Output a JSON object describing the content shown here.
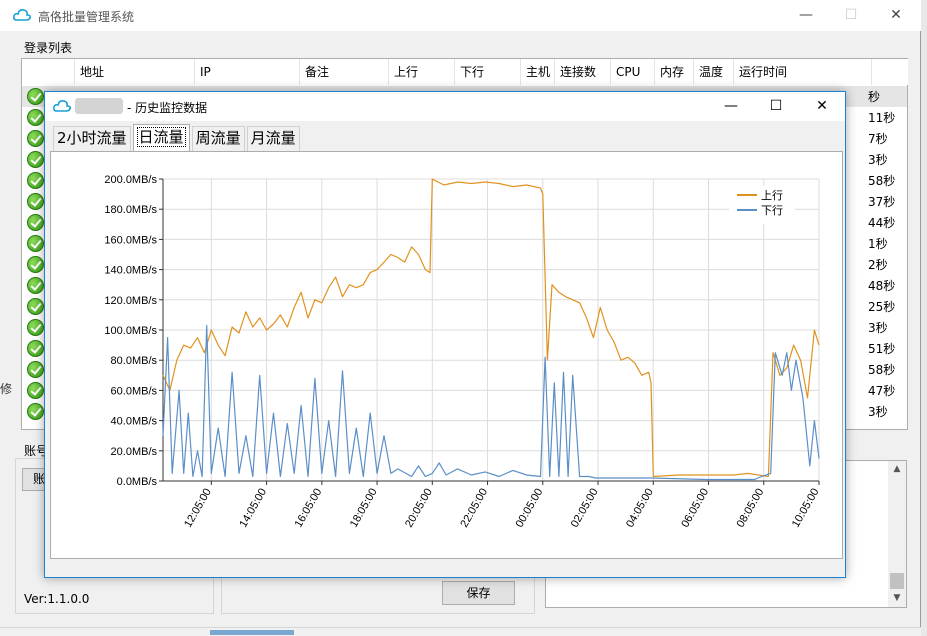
{
  "main_window": {
    "title": "高佫批量管理系统",
    "section_label": "登录列表",
    "columns": [
      "",
      "地址",
      "IP",
      "备注",
      "上行",
      "下行",
      "主机",
      "连接数",
      "CPU",
      "内存",
      "温度",
      "运行时间"
    ],
    "runtime_fragments": [
      "秒",
      "11秒",
      "7秒",
      "3秒",
      "58秒",
      "37秒",
      "44秒",
      "1秒",
      "2秒",
      "48秒",
      "25秒",
      "3秒",
      "51秒",
      "58秒",
      "47秒",
      "3秒"
    ],
    "left_fragment": "修",
    "account_label": "账号",
    "account_button_fragment": "账",
    "version": "Ver:1.1.0.0",
    "save_label": "保存"
  },
  "window_controls": {
    "minimize": "—",
    "maximize": "☐",
    "close": "✕"
  },
  "dialog": {
    "title": "- 历史监控数据",
    "tabs": [
      {
        "label": "2小时流量",
        "active": false
      },
      {
        "label": "日流量",
        "active": true
      },
      {
        "label": "周流量",
        "active": false
      },
      {
        "label": "月流量",
        "active": false
      }
    ]
  },
  "colors": {
    "upstream": "#e0921f",
    "downstream": "#5b8fc8",
    "accent_border": "#1883d7"
  },
  "icons": {
    "app": "cloud-icon"
  },
  "chart_data": {
    "type": "line",
    "y_unit": "MB/s",
    "ylim": [
      0,
      200
    ],
    "y_ticks": [
      "0.0MB/s",
      "20.0MB/s",
      "40.0MB/s",
      "60.0MB/s",
      "80.0MB/s",
      "100.0MB/s",
      "120.0MB/s",
      "140.0MB/s",
      "160.0MB/s",
      "180.0MB/s",
      "200.0MB/s"
    ],
    "x_ticks": [
      "12:05:00",
      "14:05:00",
      "16:05:00",
      "18:05:00",
      "20:05:00",
      "22:05:00",
      "00:05:00",
      "02:05:00",
      "04:05:00",
      "06:05:00",
      "08:05:00",
      "10:05:00"
    ],
    "xlim": [
      "10:20:00",
      "10:05:00"
    ],
    "grid": true,
    "legend_position": "top-right",
    "series": [
      {
        "name": "上行",
        "points": [
          [
            "10:20",
            70
          ],
          [
            "10:35",
            60
          ],
          [
            "10:50",
            80
          ],
          [
            "11:05",
            90
          ],
          [
            "11:20",
            88
          ],
          [
            "11:35",
            95
          ],
          [
            "11:50",
            85
          ],
          [
            "12:05",
            100
          ],
          [
            "12:20",
            90
          ],
          [
            "12:35",
            83
          ],
          [
            "12:50",
            102
          ],
          [
            "13:05",
            98
          ],
          [
            "13:20",
            112
          ],
          [
            "13:35",
            102
          ],
          [
            "13:50",
            108
          ],
          [
            "14:05",
            100
          ],
          [
            "14:20",
            104
          ],
          [
            "14:35",
            110
          ],
          [
            "14:50",
            102
          ],
          [
            "15:05",
            115
          ],
          [
            "15:20",
            125
          ],
          [
            "15:35",
            108
          ],
          [
            "15:50",
            120
          ],
          [
            "16:05",
            118
          ],
          [
            "16:20",
            128
          ],
          [
            "16:35",
            135
          ],
          [
            "16:50",
            122
          ],
          [
            "17:05",
            130
          ],
          [
            "17:20",
            128
          ],
          [
            "17:35",
            130
          ],
          [
            "17:50",
            138
          ],
          [
            "18:05",
            140
          ],
          [
            "18:20",
            145
          ],
          [
            "18:35",
            150
          ],
          [
            "18:50",
            148
          ],
          [
            "19:05",
            145
          ],
          [
            "19:20",
            155
          ],
          [
            "19:35",
            150
          ],
          [
            "19:50",
            140
          ],
          [
            "20:00",
            138
          ],
          [
            "20:05",
            200
          ],
          [
            "20:30",
            196
          ],
          [
            "21:00",
            198
          ],
          [
            "21:30",
            197
          ],
          [
            "22:00",
            198
          ],
          [
            "22:30",
            197
          ],
          [
            "23:00",
            195
          ],
          [
            "23:30",
            196
          ],
          [
            "00:00",
            194
          ],
          [
            "00:05",
            190
          ],
          [
            "00:15",
            80
          ],
          [
            "00:25",
            130
          ],
          [
            "00:40",
            125
          ],
          [
            "00:55",
            122
          ],
          [
            "01:10",
            120
          ],
          [
            "01:25",
            118
          ],
          [
            "01:40",
            108
          ],
          [
            "01:55",
            95
          ],
          [
            "02:10",
            115
          ],
          [
            "02:25",
            100
          ],
          [
            "02:40",
            92
          ],
          [
            "02:55",
            80
          ],
          [
            "03:10",
            82
          ],
          [
            "03:25",
            78
          ],
          [
            "03:40",
            70
          ],
          [
            "03:55",
            72
          ],
          [
            "04:00",
            65
          ],
          [
            "04:05",
            3
          ],
          [
            "05:00",
            4
          ],
          [
            "06:00",
            4
          ],
          [
            "07:00",
            4
          ],
          [
            "07:30",
            5
          ],
          [
            "08:15",
            3
          ],
          [
            "08:25",
            85
          ],
          [
            "08:40",
            70
          ],
          [
            "08:55",
            75
          ],
          [
            "09:10",
            90
          ],
          [
            "09:25",
            80
          ],
          [
            "09:40",
            55
          ],
          [
            "09:55",
            100
          ],
          [
            "10:05",
            90
          ]
        ]
      },
      {
        "name": "下行",
        "points": [
          [
            "10:20",
            30
          ],
          [
            "10:30",
            95
          ],
          [
            "10:40",
            5
          ],
          [
            "10:55",
            60
          ],
          [
            "11:05",
            5
          ],
          [
            "11:15",
            45
          ],
          [
            "11:25",
            3
          ],
          [
            "11:35",
            20
          ],
          [
            "11:45",
            3
          ],
          [
            "11:55",
            103
          ],
          [
            "12:05",
            5
          ],
          [
            "12:20",
            35
          ],
          [
            "12:35",
            3
          ],
          [
            "12:50",
            72
          ],
          [
            "13:05",
            5
          ],
          [
            "13:20",
            30
          ],
          [
            "13:35",
            3
          ],
          [
            "13:50",
            70
          ],
          [
            "14:05",
            5
          ],
          [
            "14:20",
            45
          ],
          [
            "14:35",
            3
          ],
          [
            "14:50",
            38
          ],
          [
            "15:05",
            5
          ],
          [
            "15:20",
            50
          ],
          [
            "15:35",
            3
          ],
          [
            "15:50",
            68
          ],
          [
            "16:05",
            5
          ],
          [
            "16:20",
            40
          ],
          [
            "16:35",
            3
          ],
          [
            "16:50",
            73
          ],
          [
            "17:05",
            5
          ],
          [
            "17:20",
            35
          ],
          [
            "17:35",
            3
          ],
          [
            "17:50",
            45
          ],
          [
            "18:05",
            5
          ],
          [
            "18:20",
            30
          ],
          [
            "18:35",
            5
          ],
          [
            "18:50",
            8
          ],
          [
            "19:20",
            3
          ],
          [
            "19:35",
            10
          ],
          [
            "19:50",
            3
          ],
          [
            "20:05",
            5
          ],
          [
            "20:20",
            12
          ],
          [
            "20:35",
            4
          ],
          [
            "21:00",
            8
          ],
          [
            "21:30",
            4
          ],
          [
            "22:00",
            6
          ],
          [
            "22:30",
            3
          ],
          [
            "23:00",
            7
          ],
          [
            "23:30",
            4
          ],
          [
            "00:00",
            3
          ],
          [
            "00:10",
            82
          ],
          [
            "00:20",
            3
          ],
          [
            "00:30",
            65
          ],
          [
            "00:40",
            3
          ],
          [
            "00:50",
            72
          ],
          [
            "01:00",
            3
          ],
          [
            "01:10",
            70
          ],
          [
            "01:25",
            3
          ],
          [
            "01:45",
            3
          ],
          [
            "02:00",
            2
          ],
          [
            "04:00",
            2
          ],
          [
            "06:00",
            1
          ],
          [
            "07:45",
            1
          ],
          [
            "08:00",
            3
          ],
          [
            "08:20",
            5
          ],
          [
            "08:30",
            85
          ],
          [
            "08:45",
            70
          ],
          [
            "08:55",
            85
          ],
          [
            "09:05",
            60
          ],
          [
            "09:15",
            80
          ],
          [
            "09:30",
            55
          ],
          [
            "09:45",
            10
          ],
          [
            "09:55",
            40
          ],
          [
            "10:05",
            15
          ]
        ]
      }
    ]
  }
}
